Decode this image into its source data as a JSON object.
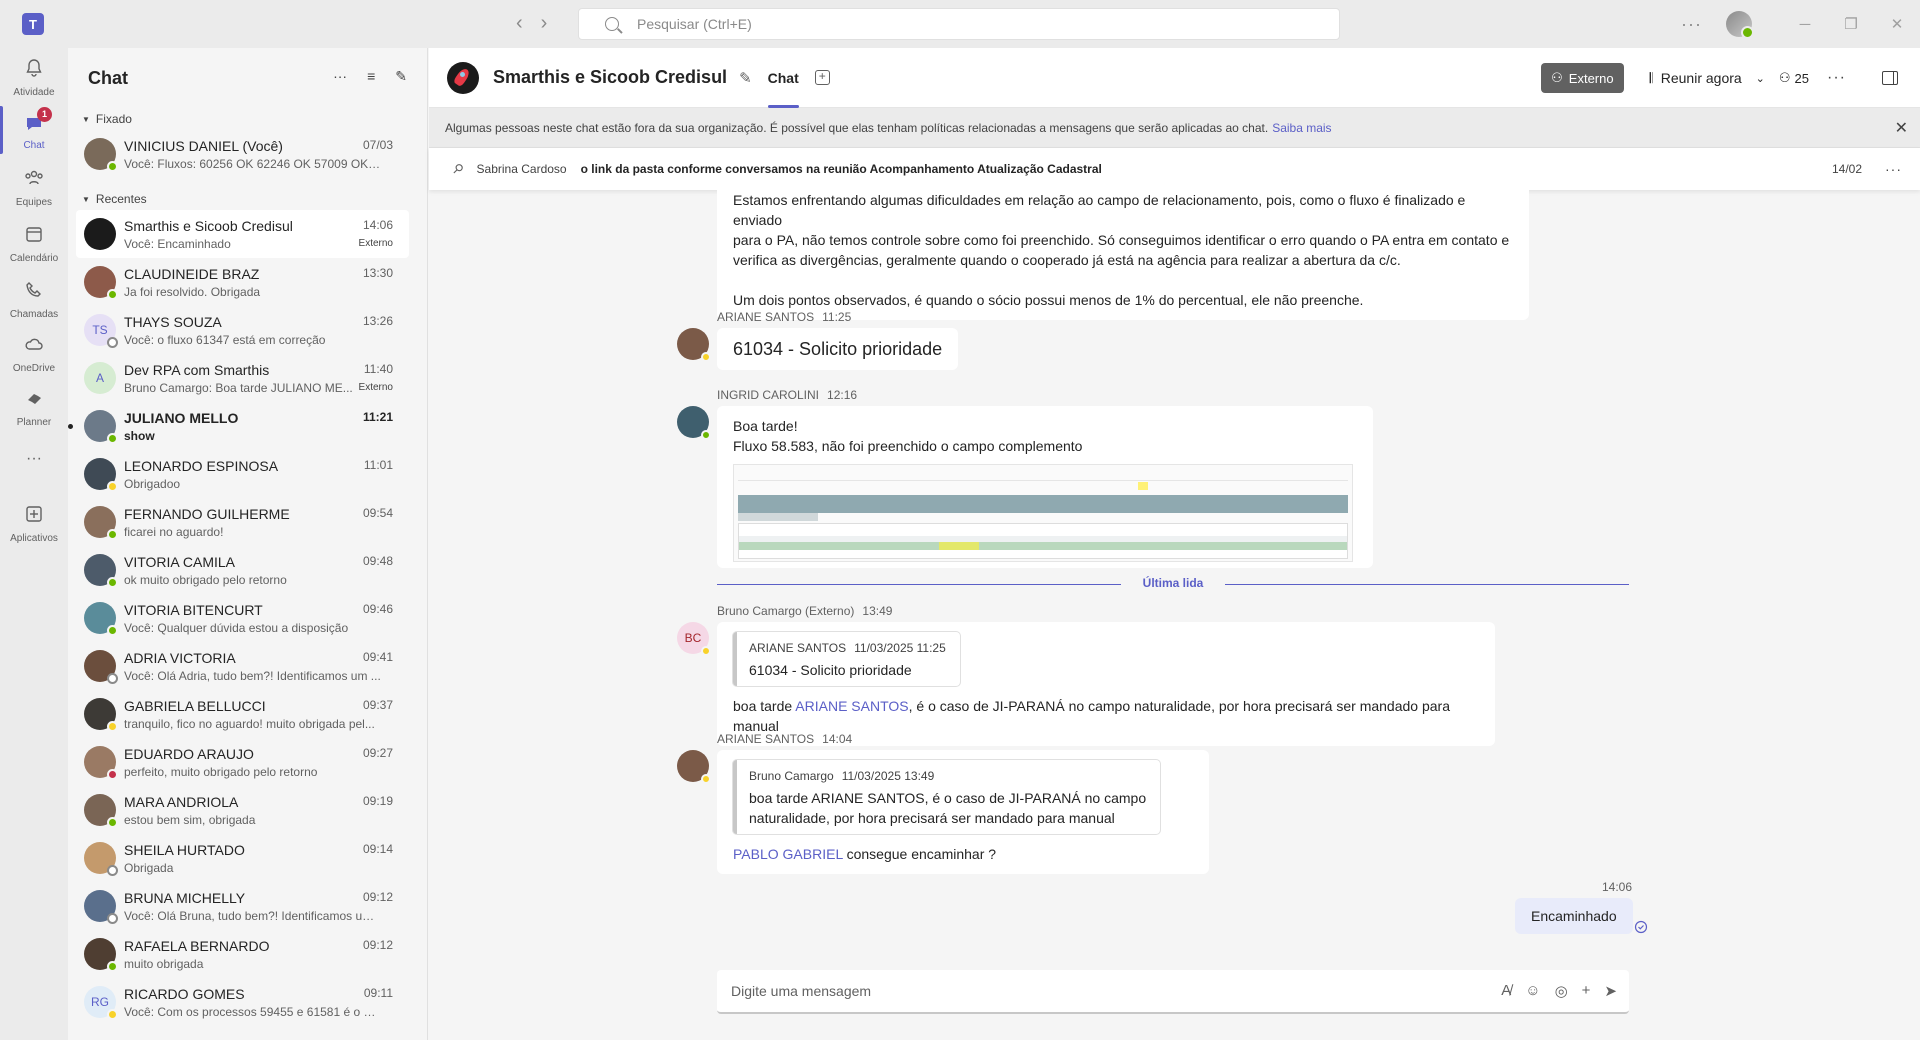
{
  "app": {
    "logo_label": "T",
    "search_placeholder": "Pesquisar (Ctrl+E)",
    "nav_back": "‹",
    "nav_forward": "›",
    "more": "···"
  },
  "rail": {
    "items": [
      {
        "label": "Atividade",
        "icon": "bell-icon"
      },
      {
        "label": "Chat",
        "icon": "chat-icon",
        "badge": "1"
      },
      {
        "label": "Equipes",
        "icon": "teams-icon"
      },
      {
        "label": "Calendário",
        "icon": "calendar-icon"
      },
      {
        "label": "Chamadas",
        "icon": "phone-icon"
      },
      {
        "label": "OneDrive",
        "icon": "cloud-icon"
      },
      {
        "label": "Planner",
        "icon": "planner-icon"
      },
      {
        "label": "···",
        "icon": "more-icon"
      },
      {
        "label": "Aplicativos",
        "icon": "add-app-icon"
      }
    ]
  },
  "list": {
    "title": "Chat",
    "pinned_label": "Fixado",
    "recent_label": "Recentes",
    "pinned": [
      {
        "name": "VINICIUS DANIEL (Você)",
        "preview": "Você: Fluxos: 60256 OK 62246 OK 57009 OK 57...",
        "time": "07/03",
        "presence": "avail",
        "avatar_color": "#7a6a5a"
      }
    ],
    "recent": [
      {
        "name": "Smarthis e Sicoob Credisul",
        "preview": "Você: Encaminhado",
        "time": "14:06",
        "tag": "Externo",
        "presence": "",
        "avatar_color": "#1b1b1b",
        "selected": true
      },
      {
        "name": "CLAUDINEIDE BRAZ",
        "preview": "Ja foi resolvido. Obrigada",
        "time": "13:30",
        "presence": "avail",
        "avatar_color": "#8d5a4a"
      },
      {
        "name": "THAYS SOUZA",
        "preview": "Você: o fluxo 61347 está em correção",
        "time": "13:26",
        "presence": "off",
        "initials": "TS",
        "avatar_color": "#e6e0f5"
      },
      {
        "name": "Dev RPA com Smarthis",
        "preview": "Bruno Camargo: Boa tarde JULIANO ME...",
        "time": "11:40",
        "tag": "Externo",
        "presence": "",
        "initials": "A",
        "avatar_color": "#d6ecd2"
      },
      {
        "name": "JULIANO MELLO",
        "preview": "show",
        "time": "11:21",
        "presence": "avail",
        "avatar_color": "#6c7a89",
        "unread": true
      },
      {
        "name": "LEONARDO ESPINOSA",
        "preview": "Obrigadoo",
        "time": "11:01",
        "presence": "away",
        "avatar_color": "#3f4a55"
      },
      {
        "name": "FERNANDO GUILHERME",
        "preview": "ficarei no aguardo!",
        "time": "09:54",
        "presence": "avail",
        "avatar_color": "#8a6f5c"
      },
      {
        "name": "VITORIA CAMILA",
        "preview": "ok muito obrigado pelo retorno",
        "time": "09:48",
        "presence": "avail",
        "avatar_color": "#4d5b6a"
      },
      {
        "name": "VITORIA BITENCURT",
        "preview": "Você: Qualquer dúvida estou a disposição",
        "time": "09:46",
        "presence": "avail",
        "avatar_color": "#5a8c9a"
      },
      {
        "name": "ADRIA VICTORIA",
        "preview": "Você: Olá Adria, tudo bem?! Identificamos um ...",
        "time": "09:41",
        "presence": "off",
        "avatar_color": "#6b4e3d"
      },
      {
        "name": "GABRIELA BELLUCCI",
        "preview": "tranquilo, fico no aguardo! muito obrigada pel...",
        "time": "09:37",
        "presence": "away",
        "avatar_color": "#3d3a36"
      },
      {
        "name": "EDUARDO ARAUJO",
        "preview": "perfeito, muito obrigado pelo retorno",
        "time": "09:27",
        "presence": "busy",
        "avatar_color": "#9a7a64"
      },
      {
        "name": "MARA ANDRIOLA",
        "preview": "estou bem sim, obrigada",
        "time": "09:19",
        "presence": "avail",
        "avatar_color": "#7a6555"
      },
      {
        "name": "SHEILA HURTADO",
        "preview": "Obrigada",
        "time": "09:14",
        "presence": "off",
        "avatar_color": "#c49a6c"
      },
      {
        "name": "BRUNA MICHELLY",
        "preview": "Você: Olá Bruna, tudo bem?! Identificamos um ...",
        "time": "09:12",
        "presence": "off",
        "avatar_color": "#5a6f8c"
      },
      {
        "name": "RAFAELA BERNARDO",
        "preview": "muito obrigada",
        "time": "09:12",
        "presence": "avail",
        "avatar_color": "#4f3e32"
      },
      {
        "name": "RICARDO GOMES",
        "preview": "Você: Com os processos 59455 e 61581 é o me...",
        "time": "09:11",
        "presence": "away",
        "initials": "RG",
        "avatar_color": "#e0ecf7"
      }
    ]
  },
  "header": {
    "title": "Smarthis e Sicoob Credisul",
    "tab": "Chat",
    "external_label": "Externo",
    "meet_label": "Reunir agora",
    "participants": "25"
  },
  "notice": {
    "text": "Algumas pessoas neste chat estão fora da sua organização. É possível que elas tenham políticas relacionadas a mensagens que serão aplicadas ao chat.",
    "link": "Saiba mais"
  },
  "pinned_msg": {
    "author": "Sabrina Cardoso",
    "text": "o link da pasta conforme conversamos na reunião Acompanhamento Atualização Cadastral",
    "date": "14/02"
  },
  "messages": {
    "m0": {
      "line1": "Estamos enfrentando algumas dificuldades em relação ao campo de relacionamento, pois, como o fluxo é finalizado e enviado",
      "line2": "para o PA, não temos controle sobre como foi preenchido. Só conseguimos identificar o erro quando o PA entra em contato e",
      "line3": "verifica as divergências, geralmente quando o cooperado já está na agência para realizar a abertura da c/c.",
      "line4": "Um dois pontos observados, é quando o sócio possui menos de 1% do percentual, ele não preenche."
    },
    "m1": {
      "author": "ARIANE SANTOS",
      "time": "11:25",
      "text": "61034 - Solicito prioridade"
    },
    "m2": {
      "author": "INGRID CAROLINI",
      "time": "12:16",
      "line1": "Boa tarde!",
      "line2": "Fluxo 58.583, não foi preenchido o campo complemento"
    },
    "last_read": "Última lida",
    "m3": {
      "author": "Bruno Camargo (Externo)",
      "time": "13:49",
      "initials": "BC",
      "quote_author": "ARIANE SANTOS",
      "quote_time": "11/03/2025 11:25",
      "quote_text": "61034 - Solicito prioridade",
      "text_a": "boa tarde ",
      "mention": "ARIANE SANTOS",
      "text_b": ", é o caso de JI-PARANÁ no campo naturalidade, por hora precisará ser mandado para manual"
    },
    "m4": {
      "author": "ARIANE SANTOS",
      "time": "14:04",
      "quote_author": "Bruno Camargo",
      "quote_time": "11/03/2025 13:49",
      "quote_line1": "boa tarde ARIANE SANTOS, é o caso de JI-PARANÁ no campo",
      "quote_line2": "naturalidade, por hora precisará ser mandado para manual",
      "mention": "PABLO GABRIEL",
      "text": " consegue encaminhar ?"
    },
    "m5": {
      "time": "14:06",
      "text": "Encaminhado"
    }
  },
  "composer": {
    "placeholder": "Digite uma mensagem"
  },
  "colors": {
    "accent": "#5b5fc7",
    "available": "#6bb700",
    "away": "#f8d22a",
    "busy": "#c4314b"
  }
}
